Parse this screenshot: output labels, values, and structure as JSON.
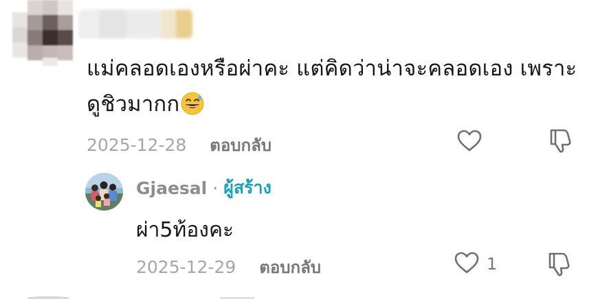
{
  "comment": {
    "text_line1": "แม่คลอดเองหรือผ่าคะ แต่คิดว่าน่าจะคลอดเอง เพราะ",
    "text_line2": "ดูชิวมากก",
    "emoji": "sweat-smile-emoji",
    "date": "2025-12-28",
    "reply_label": "ตอบกลับ",
    "like_icon": "heart-outline-icon",
    "dislike_icon": "thumbs-down-outline-icon"
  },
  "reply": {
    "username": "Gjaesal",
    "separator": "·",
    "creator_badge": "ผู้สร้าง",
    "text": "ผ่า5ท้องคะ",
    "date": "2025-12-29",
    "reply_label": "ตอบกลับ",
    "like_count": "1",
    "like_icon": "heart-outline-icon",
    "dislike_icon": "thumbs-down-outline-icon"
  },
  "colors": {
    "text": "#161616",
    "meta": "#a6a6a6",
    "reply_action": "#777777",
    "creator_accent": "#1c9fb8",
    "icon_stroke": "#6f6f6f"
  }
}
